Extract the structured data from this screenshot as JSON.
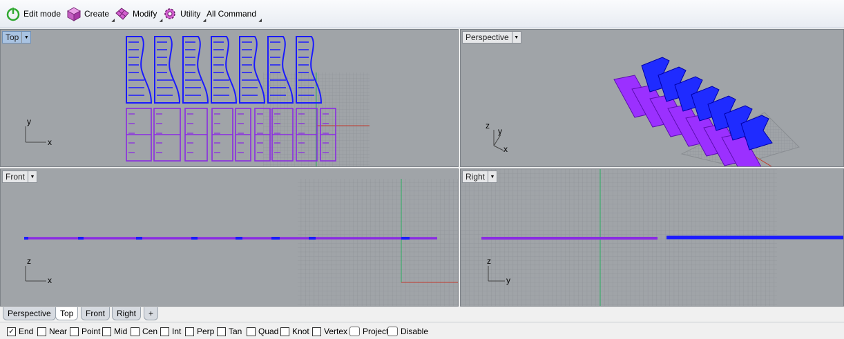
{
  "toolbar": {
    "edit_mode": "Edit mode",
    "create": "Create",
    "modify": "Modify",
    "utility": "Utility",
    "all_command": "All Command"
  },
  "viewports": {
    "top": {
      "name": "Top",
      "axis1": "y",
      "axis2": "x"
    },
    "perspective": {
      "name": "Perspective",
      "axis1": "z",
      "axis2": "y",
      "axis3": "x"
    },
    "front": {
      "name": "Front",
      "axis1": "z",
      "axis2": "x"
    },
    "right": {
      "name": "Right",
      "axis1": "z",
      "axis2": "y"
    }
  },
  "tabs": [
    "Perspective",
    "Top",
    "Front",
    "Right",
    "+"
  ],
  "active_tab": "Top",
  "snaps": [
    {
      "label": "End",
      "checked": true
    },
    {
      "label": "Near",
      "checked": false
    },
    {
      "label": "Point",
      "checked": false
    },
    {
      "label": "Mid",
      "checked": false
    },
    {
      "label": "Cen",
      "checked": false
    },
    {
      "label": "Int",
      "checked": false
    },
    {
      "label": "Perp",
      "checked": false
    },
    {
      "label": "Tan",
      "checked": false
    },
    {
      "label": "Quad",
      "checked": false
    },
    {
      "label": "Knot",
      "checked": false
    },
    {
      "label": "Vertex",
      "checked": false
    }
  ],
  "toggles": [
    {
      "label": "Project",
      "on": false
    },
    {
      "label": "Disable",
      "on": false
    }
  ],
  "colors": {
    "viewport_bg": "#a0a4a8",
    "grid": "#8e9296",
    "blue_curves": "#1a1aff",
    "purple_curves": "#8a2be2",
    "x_axis": "#c0392b",
    "y_axis": "#27ae60",
    "active_tab": "#a9c3e2"
  }
}
